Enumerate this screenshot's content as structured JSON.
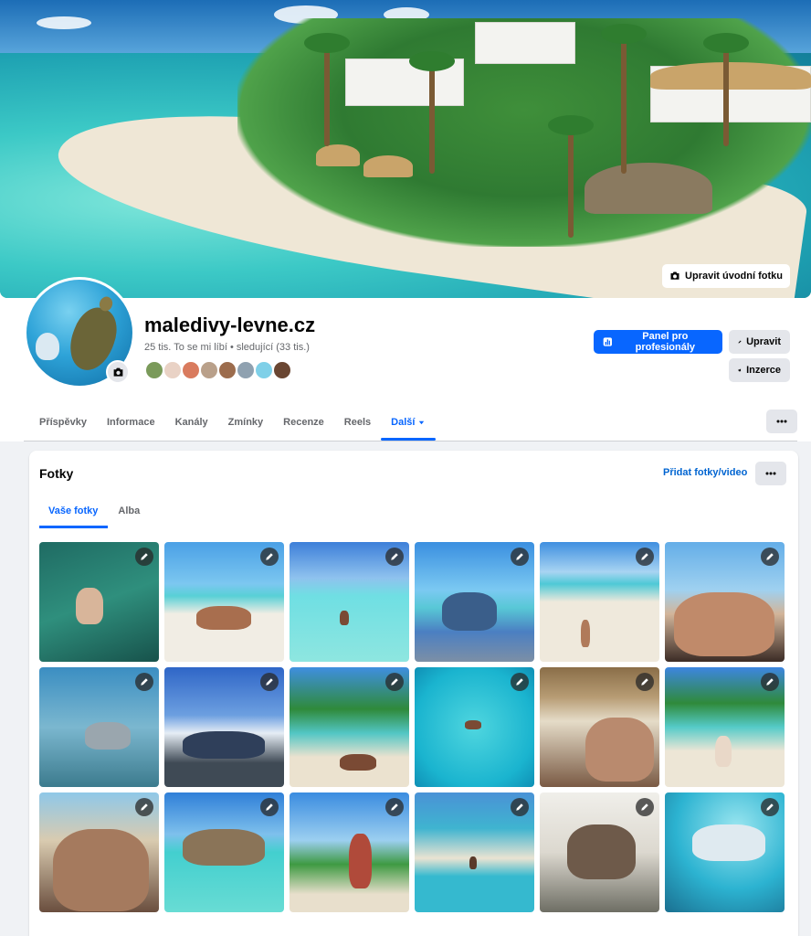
{
  "cover": {
    "edit_label": "Upravit úvodní fotku"
  },
  "profile": {
    "name": "maledivy-levne.cz",
    "stats": "25 tis. To se mi líbí • sledující (33 tis.)",
    "friend_colors": [
      "#7a9a5a",
      "#e9d2c5",
      "#d97b5e",
      "#b9a08a",
      "#9c6c4d",
      "#8fa1b0",
      "#7fd0e8",
      "#6a4632"
    ]
  },
  "actions": {
    "professional_label": "Panel pro profesionály",
    "edit_label": "Upravit",
    "ads_label": "Inzerce"
  },
  "tabs": [
    {
      "label": "Příspěvky"
    },
    {
      "label": "Informace"
    },
    {
      "label": "Kanály"
    },
    {
      "label": "Zmínky"
    },
    {
      "label": "Recenze"
    },
    {
      "label": "Reels"
    },
    {
      "label": "Další"
    }
  ],
  "photos_section": {
    "title": "Fotky",
    "add_label": "Přidat fotky/video",
    "sub_tabs": [
      {
        "label": "Vaše fotky"
      },
      {
        "label": "Alba"
      }
    ]
  },
  "colors": {
    "accent": "#0866ff",
    "link": "#0064d1",
    "muted": "#65676b"
  },
  "photos": [
    {
      "subject": "snorkeling",
      "bg": "linear-gradient(160deg,#1f6b63,#2f8f7d 50%,#17524b)"
    },
    {
      "subject": "couple on beach",
      "bg": "linear-gradient(180deg,#4aa0e6 0%,#7cc7f0 35%,#58d0d6 45%,#f1ede4 60%)"
    },
    {
      "subject": "lagoon",
      "bg": "linear-gradient(180deg,#3d7fd9 0%,#8fc2ee 30%,#6fdfe3 45%,#8ee6e0 100%)"
    },
    {
      "subject": "jetty",
      "bg": "linear-gradient(180deg,#3a8fe0 0%,#7bc9f2 40%,#58c8d6 55%,#4b7fc2 75%,#7c8fa6 100%)"
    },
    {
      "subject": "sandbank",
      "bg": "linear-gradient(180deg,#3f8fe0 0%,#a8d4f2 25%,#4ec9d6 35%,#efe9dc 50%)"
    },
    {
      "subject": "selfie couple",
      "bg": "linear-gradient(180deg,#64aee8 0%,#9fd1f0 40%,#d2b59a 60%,#3b2b25 100%)"
    },
    {
      "subject": "sharks",
      "bg": "linear-gradient(180deg,#3b8ec2,#7bb7cf 50%,#3c7b8e)"
    },
    {
      "subject": "maldives sign",
      "bg": "linear-gradient(180deg,#2f66c7 0%,#6c9fe0 40%,#e6edf5 55%,#3f4a55 80%)"
    },
    {
      "subject": "lying on beach",
      "bg": "linear-gradient(180deg,#3f8fe0 0%,#2f8a3a 35%,#52c6c4 55%,#ebe2cf 75%)"
    },
    {
      "subject": "swimming",
      "bg": "radial-gradient(circle at 50% 50%,#4fd6df,#1ab4cf 70%,#0f8fb5)"
    },
    {
      "subject": "selfie hut",
      "bg": "linear-gradient(180deg,#8a6e48 0%,#b79c74 25%,#e5dcc8 45%,#7a5a44 100%)"
    },
    {
      "subject": "beach walk",
      "bg": "linear-gradient(180deg,#3d86e0 0%,#2f8a3a 30%,#55cbc8 50%,#ede6d6 70%)"
    },
    {
      "subject": "selfie cap",
      "bg": "linear-gradient(180deg,#8fc8e8 0%,#d9cbb0 40%,#6a4e3e 100%)"
    },
    {
      "subject": "swing",
      "bg": "linear-gradient(180deg,#2f7fd8 0%,#7ec0ec 35%,#43cfcf 50%,#68dcd4 100%)"
    },
    {
      "subject": "palm tree",
      "bg": "linear-gradient(180deg,#3a8ce0 0%,#9ccff0 40%,#3e9a42 60%,#e8dfcc 85%)"
    },
    {
      "subject": "sandbar aerial",
      "bg": "linear-gradient(180deg,#4a92d6 0%,#3fb4d0 30%,#eae3d2 55%,#35b9cf 70%)"
    },
    {
      "subject": "couple indoors",
      "bg": "linear-gradient(180deg,#f0efea 0%,#dcd8cf 50%,#6e6e64 100%)"
    },
    {
      "subject": "manta illustration",
      "bg": "radial-gradient(circle at 60% 30%,#9be6f0,#2cb3d1 55%,#1a6f90)"
    }
  ]
}
